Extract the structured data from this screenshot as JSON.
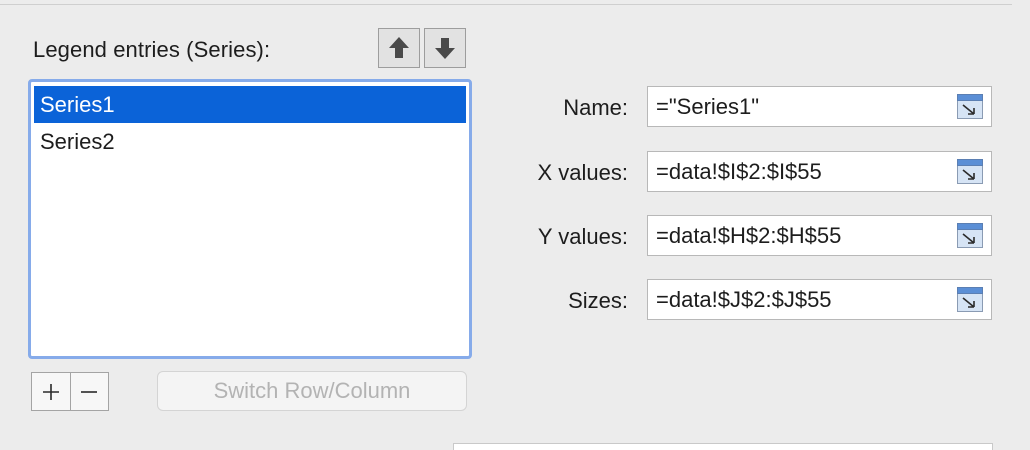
{
  "legend": {
    "title": "Legend entries (Series):",
    "move_up_icon": "arrow-up-icon",
    "move_down_icon": "arrow-down-icon",
    "series": [
      {
        "label": "Series1",
        "selected": true
      },
      {
        "label": "Series2",
        "selected": false
      }
    ],
    "add_icon": "plus-icon",
    "remove_icon": "minus-icon",
    "switch_label": "Switch Row/Column",
    "switch_enabled": false
  },
  "fields": {
    "name": {
      "label": "Name:",
      "value": "=\"Series1\""
    },
    "x_values": {
      "label": "X values:",
      "value": "=data!$I$2:$I$55"
    },
    "y_values": {
      "label": "Y values:",
      "value": "=data!$H$2:$H$55"
    },
    "sizes": {
      "label": "Sizes:",
      "value": "=data!$J$2:$J$55"
    },
    "range_picker_icon": "range-select-icon"
  },
  "colors": {
    "selection": "#0b63d8",
    "focus_ring": "#86abea",
    "window_bg": "#ececec"
  }
}
